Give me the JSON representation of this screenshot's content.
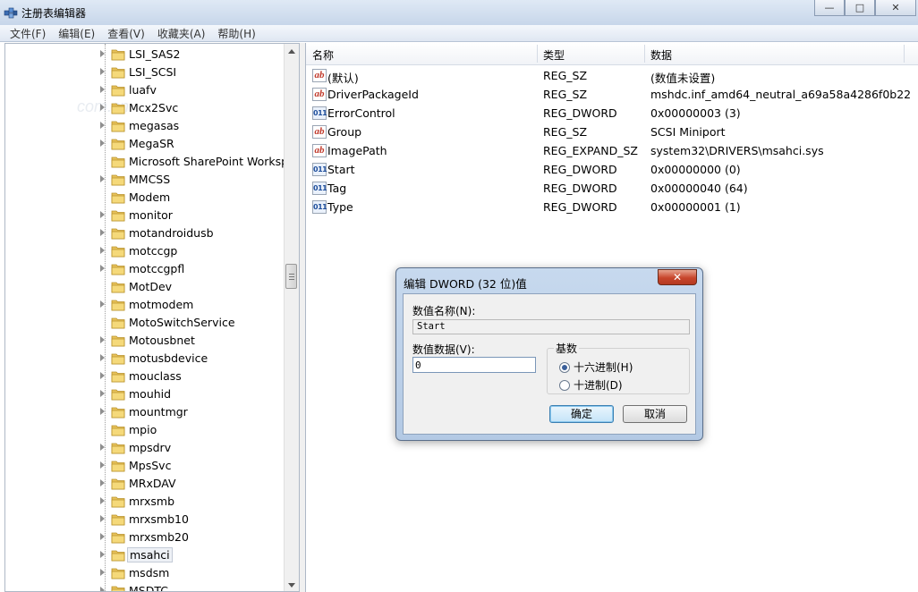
{
  "window": {
    "title": "注册表编辑器",
    "controls": {
      "minimize": "—",
      "maximize": "□",
      "close": "✕"
    }
  },
  "menu": [
    "文件(F)",
    "编辑(E)",
    "查看(V)",
    "收藏夹(A)",
    "帮助(H)"
  ],
  "tree": {
    "watermark": "com.cn",
    "items": [
      {
        "label": "LSI_SAS2",
        "expandable": true
      },
      {
        "label": "LSI_SCSI",
        "expandable": true
      },
      {
        "label": "luafv",
        "expandable": true
      },
      {
        "label": "Mcx2Svc",
        "expandable": true
      },
      {
        "label": "megasas",
        "expandable": true
      },
      {
        "label": "MegaSR",
        "expandable": true
      },
      {
        "label": "Microsoft SharePoint Workspa",
        "expandable": false
      },
      {
        "label": "MMCSS",
        "expandable": true
      },
      {
        "label": "Modem",
        "expandable": false
      },
      {
        "label": "monitor",
        "expandable": true
      },
      {
        "label": "motandroidusb",
        "expandable": true
      },
      {
        "label": "motccgp",
        "expandable": true
      },
      {
        "label": "motccgpfl",
        "expandable": true
      },
      {
        "label": "MotDev",
        "expandable": false
      },
      {
        "label": "motmodem",
        "expandable": true
      },
      {
        "label": "MotoSwitchService",
        "expandable": false
      },
      {
        "label": "Motousbnet",
        "expandable": true
      },
      {
        "label": "motusbdevice",
        "expandable": true
      },
      {
        "label": "mouclass",
        "expandable": true
      },
      {
        "label": "mouhid",
        "expandable": true
      },
      {
        "label": "mountmgr",
        "expandable": true
      },
      {
        "label": "mpio",
        "expandable": false
      },
      {
        "label": "mpsdrv",
        "expandable": true
      },
      {
        "label": "MpsSvc",
        "expandable": true
      },
      {
        "label": "MRxDAV",
        "expandable": true
      },
      {
        "label": "mrxsmb",
        "expandable": true
      },
      {
        "label": "mrxsmb10",
        "expandable": true
      },
      {
        "label": "mrxsmb20",
        "expandable": true
      },
      {
        "label": "msahci",
        "expandable": true,
        "selected": true
      },
      {
        "label": "msdsm",
        "expandable": true
      },
      {
        "label": "MSDTC",
        "expandable": true
      }
    ]
  },
  "values": {
    "headers": {
      "name": "名称",
      "type": "类型",
      "data": "数据"
    },
    "rows": [
      {
        "icon": "ab",
        "name": "(默认)",
        "type": "REG_SZ",
        "data": "(数值未设置)"
      },
      {
        "icon": "ab",
        "name": "DriverPackageId",
        "type": "REG_SZ",
        "data": "mshdc.inf_amd64_neutral_a69a58a4286f0b22"
      },
      {
        "icon": "dword",
        "name": "ErrorControl",
        "type": "REG_DWORD",
        "data": "0x00000003 (3)"
      },
      {
        "icon": "ab",
        "name": "Group",
        "type": "REG_SZ",
        "data": "SCSI Miniport"
      },
      {
        "icon": "ab",
        "name": "ImagePath",
        "type": "REG_EXPAND_SZ",
        "data": "system32\\DRIVERS\\msahci.sys"
      },
      {
        "icon": "dword",
        "name": "Start",
        "type": "REG_DWORD",
        "data": "0x00000000 (0)"
      },
      {
        "icon": "dword",
        "name": "Tag",
        "type": "REG_DWORD",
        "data": "0x00000040 (64)"
      },
      {
        "icon": "dword",
        "name": "Type",
        "type": "REG_DWORD",
        "data": "0x00000001 (1)"
      }
    ]
  },
  "dialog": {
    "title": "编辑 DWORD (32 位)值",
    "close": "✕",
    "name_label": "数值名称(N):",
    "name_value": "Start",
    "data_label": "数值数据(V):",
    "data_value": "0",
    "base_label": "基数",
    "base_options": [
      {
        "label": "十六进制(H)",
        "checked": true
      },
      {
        "label": "十进制(D)",
        "checked": false
      }
    ],
    "ok": "确定",
    "cancel": "取消"
  }
}
